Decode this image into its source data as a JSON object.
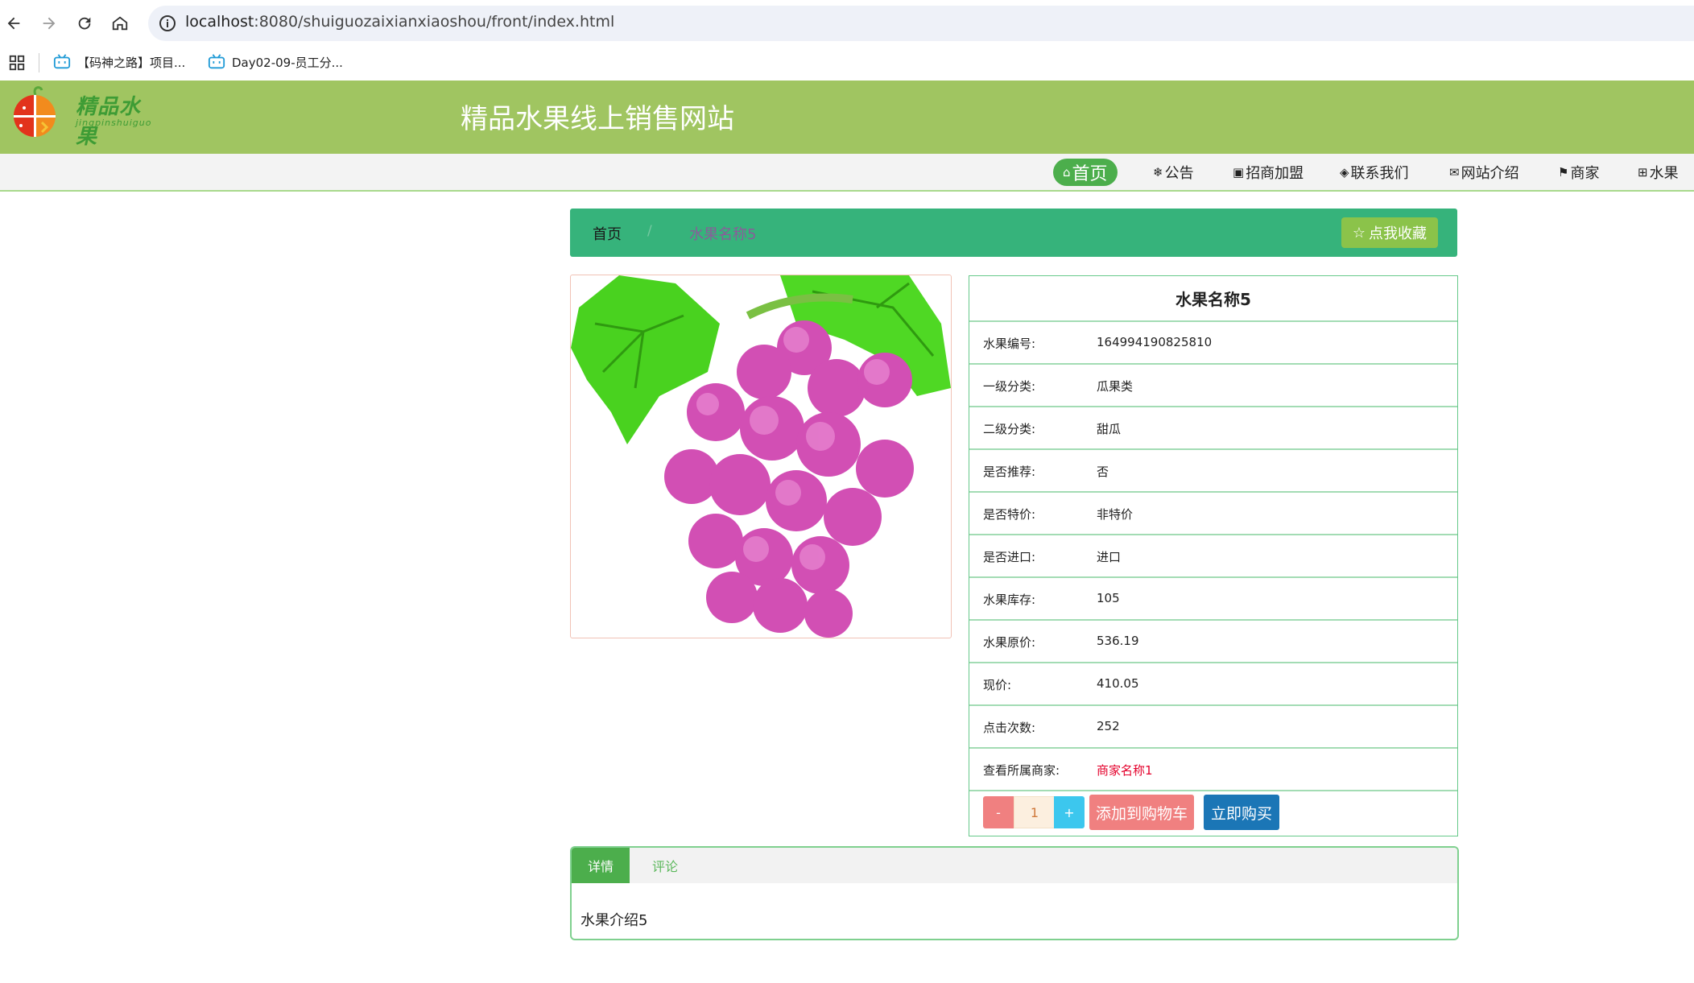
{
  "browser": {
    "url_host": "localhost",
    "url_path": ":8080/shuiguozaixianxiaoshou/front/index.html",
    "bookmarks": [
      {
        "label": "【码神之路】项目...",
        "icon": "bilibili-icon"
      },
      {
        "label": "Day02-09-员工分...",
        "icon": "bilibili-icon"
      }
    ]
  },
  "header": {
    "logo_text": "精品水果",
    "logo_sub": "jingpinshuiguo",
    "site_title": "精品水果线上销售网站",
    "bg_color": "#a0c561"
  },
  "nav": {
    "items": [
      {
        "label": "首页",
        "icon": "home-icon",
        "glyph": "⌂",
        "active": true
      },
      {
        "label": "公告",
        "icon": "snowflake-icon",
        "glyph": "❄"
      },
      {
        "label": "招商加盟",
        "icon": "clipboard-icon",
        "glyph": "▣"
      },
      {
        "label": "联系我们",
        "icon": "layers-icon",
        "glyph": "◈"
      },
      {
        "label": "网站介绍",
        "icon": "mail-icon",
        "glyph": "✉"
      },
      {
        "label": "商家",
        "icon": "flag-icon",
        "glyph": "⚑"
      },
      {
        "label": "水果",
        "icon": "gift-icon",
        "glyph": "⊞"
      }
    ]
  },
  "breadcrumb": {
    "home": "首页",
    "separator": "/",
    "current": "水果名称5",
    "favorite_label": "点我收藏"
  },
  "product": {
    "name": "水果名称5",
    "fields": [
      {
        "key": "水果编号:",
        "value": "164994190825810"
      },
      {
        "key": "一级分类:",
        "value": "瓜果类"
      },
      {
        "key": "二级分类:",
        "value": "甜瓜"
      },
      {
        "key": "是否推荐:",
        "value": "否"
      },
      {
        "key": "是否特价:",
        "value": "非特价"
      },
      {
        "key": "是否进口:",
        "value": "进口"
      },
      {
        "key": "水果库存:",
        "value": "105"
      },
      {
        "key": "水果原价:",
        "value": "536.19"
      },
      {
        "key": "现价:",
        "value": "410.05"
      },
      {
        "key": "点击次数:",
        "value": "252"
      },
      {
        "key": "查看所属商家:",
        "value": "商家名称1",
        "link": true
      }
    ],
    "qty_minus": "-",
    "qty_value": "1",
    "qty_plus": "+",
    "add_to_cart": "添加到购物车",
    "buy_now": "立即购买"
  },
  "tabs": {
    "items": [
      {
        "label": "详情",
        "active": true
      },
      {
        "label": "评论"
      }
    ],
    "content": "水果介绍5"
  }
}
